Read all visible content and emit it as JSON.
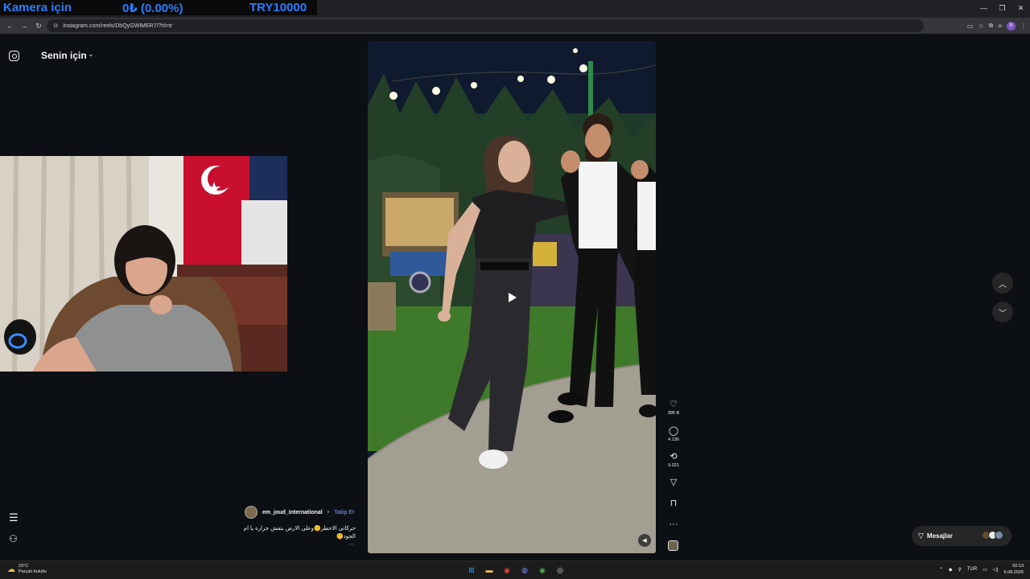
{
  "overlay": {
    "label": "Kamera için",
    "amount": "0₺ (0.00%)",
    "goal": "TRY10000"
  },
  "browser": {
    "url": "instagram.com/reels/DbQyGWIMER7/?hl=tr",
    "profile_initial": "h",
    "window_controls": {
      "minimize": "—",
      "restore": "❐",
      "close": "✕"
    }
  },
  "instagram": {
    "feed_title": "Senin için",
    "author": {
      "username": "em_joud_international",
      "follow_label": "Takip Et"
    },
    "caption": "حركاتي الاحطر🤫وعلى الارض بتفش جزارة يا ام الجود🤫",
    "caption_more": "...",
    "actions": {
      "likes": "395 B",
      "comments": "4.136",
      "reposts": "9.021"
    },
    "messages_label": "Mesajlar"
  },
  "taskbar": {
    "weather_temp": "23°C",
    "weather_desc": "Parçalı bulutlu",
    "language": "TUR",
    "time": "00:13",
    "date": "6.08.2026"
  },
  "icons": {
    "instagram": "instagram-icon",
    "chevron": "chevron-down-icon",
    "like": "heart-icon",
    "comment": "comment-icon",
    "repost": "repost-icon",
    "share": "send-icon",
    "save": "bookmark-icon",
    "more": "more-icon",
    "play": "play-icon",
    "mute": "speaker-icon",
    "menu": "hamburger-icon",
    "meta": "meta-icon"
  },
  "colors": {
    "page_bg": "#0c1014",
    "accent_blue": "#2a7dff",
    "follow_link": "#8d9eff",
    "pill_bg": "#262626"
  }
}
